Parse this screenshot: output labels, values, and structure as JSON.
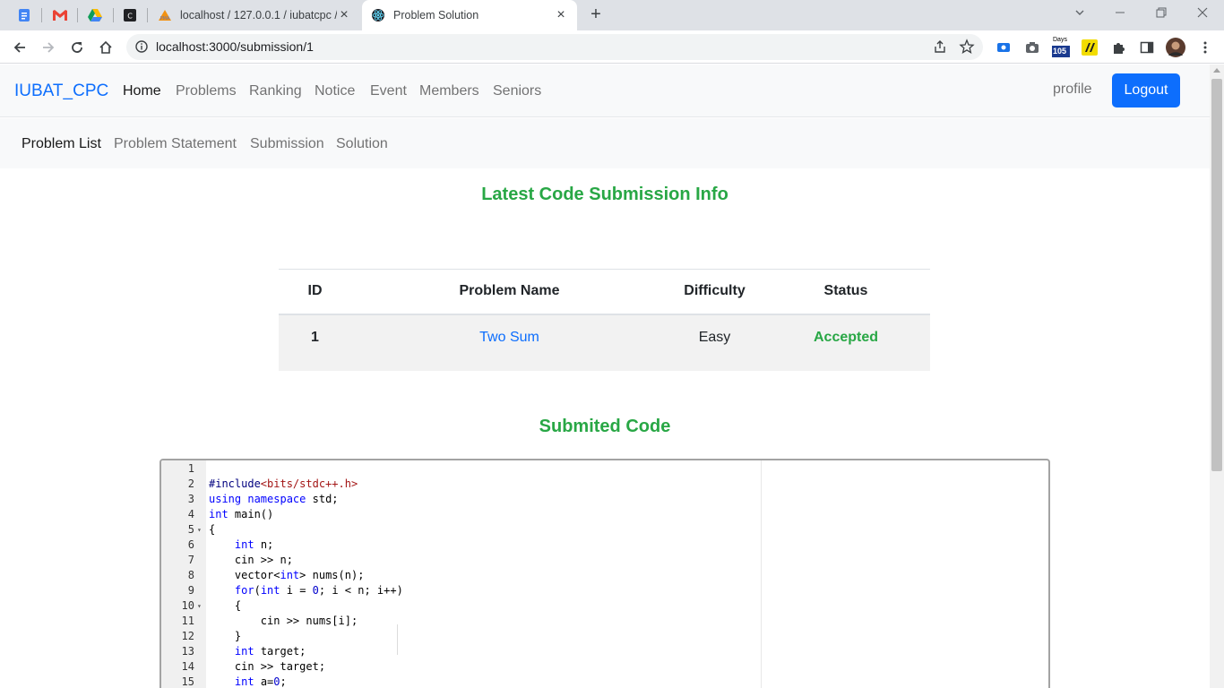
{
  "browser": {
    "tabs": [
      {
        "title": "localhost / 127.0.0.1 / iubatcpc /",
        "favicon": "phpmyadmin-icon",
        "active": false
      },
      {
        "title": "Problem Solution",
        "favicon": "react-icon",
        "active": true
      }
    ],
    "url": "localhost:3000/submission/1",
    "ext_badge": "105",
    "ext_badge_top": "Days"
  },
  "navbar": {
    "brand": "IUBAT_CPC",
    "links": [
      "Home",
      "Problems",
      "Ranking",
      "Notice",
      "Event",
      "Members",
      "Seniors"
    ],
    "profile": "profile",
    "logout": "Logout"
  },
  "subnav": {
    "links": [
      "Problem List",
      "Problem Statement",
      "Submission",
      "Solution"
    ]
  },
  "main": {
    "heading": "Latest Code Submission Info",
    "table": {
      "headers": [
        "ID",
        "Problem Name",
        "Difficulty",
        "Status"
      ],
      "rows": [
        {
          "id": "1",
          "name": "Two Sum",
          "difficulty": "Easy",
          "status": "Accepted"
        }
      ]
    },
    "code_heading": "Submited Code"
  },
  "code": {
    "lines": [
      "",
      "#include<bits/stdc++.h>",
      "using namespace std;",
      "int main()",
      "{",
      "    int n;",
      "    cin >> n;",
      "    vector<int> nums(n);",
      "    for(int i = 0; i < n; i++)",
      "    {",
      "        cin >> nums[i];",
      "    }",
      "    int target;",
      "    cin >> target;",
      "    int a=0;"
    ],
    "fold_lines": [
      5,
      10
    ]
  },
  "colors": {
    "accent": "#0d6efd",
    "success": "#28a745"
  }
}
